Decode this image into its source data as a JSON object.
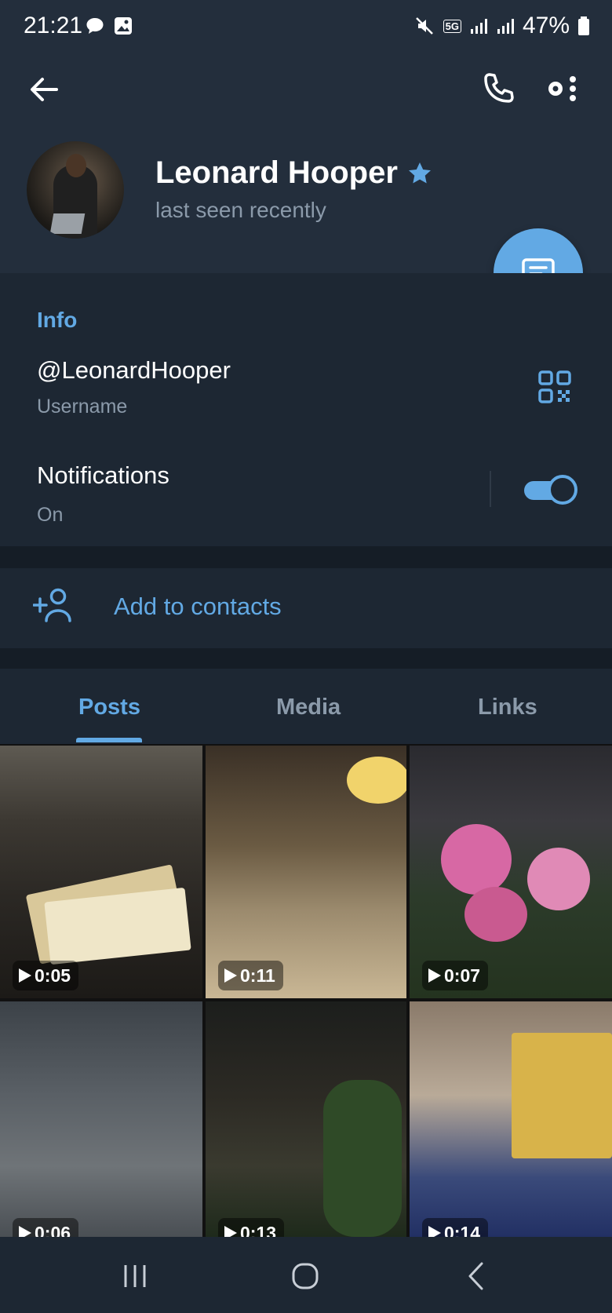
{
  "status_bar": {
    "time": "21:21",
    "network": "5G",
    "battery": "47%"
  },
  "header": {
    "name": "Leonard Hooper",
    "status": "last seen recently"
  },
  "info": {
    "section_title": "Info",
    "username": "@LeonardHooper",
    "username_label": "Username",
    "notifications_label": "Notifications",
    "notifications_value": "On",
    "notifications_enabled": true
  },
  "contacts": {
    "add_label": "Add to contacts"
  },
  "tabs": [
    {
      "label": "Posts",
      "active": true
    },
    {
      "label": "Media",
      "active": false
    },
    {
      "label": "Links",
      "active": false
    }
  ],
  "media": [
    {
      "duration": "0:05"
    },
    {
      "duration": "0:11"
    },
    {
      "duration": "0:07"
    },
    {
      "duration": "0:06"
    },
    {
      "duration": "0:13"
    },
    {
      "duration": "0:14"
    }
  ],
  "colors": {
    "accent": "#62a9e4",
    "background": "#1d2733",
    "header": "#232e3c",
    "secondary_text": "#8b9aaa"
  },
  "icons": {
    "back": "arrow-left-icon",
    "call": "phone-icon",
    "more": "more-icon",
    "verified": "star-icon",
    "message": "message-icon",
    "qr": "qr-code-icon",
    "add_contact": "add-user-icon"
  }
}
